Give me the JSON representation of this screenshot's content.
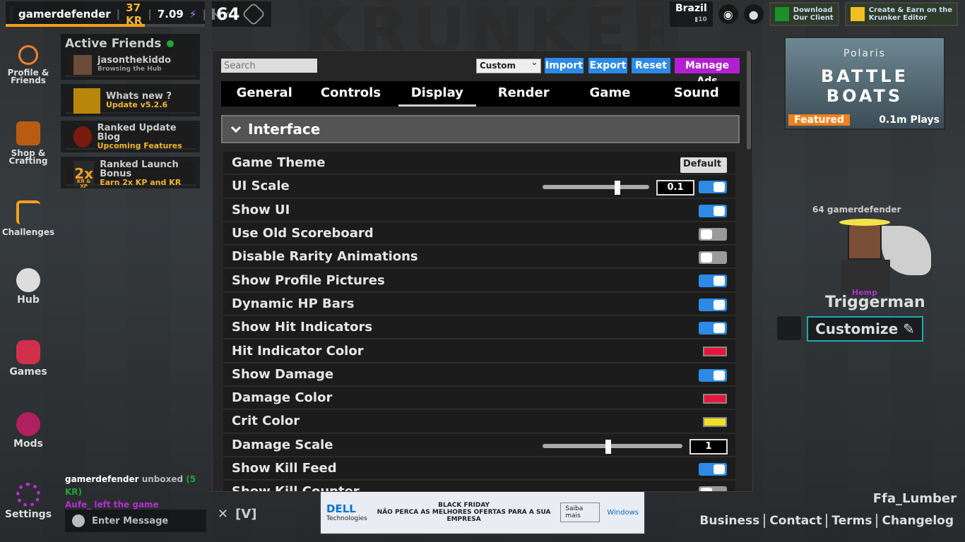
{
  "topbar": {
    "username": "gamerdefender",
    "kr": "37 KR",
    "kd": "7.09",
    "level": "64",
    "xp_fraction": 0.7,
    "region": "Brazil",
    "ping": "10",
    "promo_client_line1": "Download",
    "promo_client_line2": "Our Client",
    "promo_editor_line1": "Create & Earn on the",
    "promo_editor_line2": "Krunker Editor"
  },
  "background_logo": "KRUNKER",
  "sidebar": {
    "items": [
      {
        "label": "Profile & Friends"
      },
      {
        "label": "Shop & Crafting"
      },
      {
        "label": "Challenges"
      },
      {
        "label": "Hub"
      },
      {
        "label": "Games"
      },
      {
        "label": "Mods"
      },
      {
        "label": "Settings"
      }
    ]
  },
  "friends_panel": {
    "title": "Active Friends",
    "friend_name": "jasonthekiddo",
    "friend_status": "Browsing the Hub",
    "news": [
      {
        "title": "Whats new ?",
        "subtitle": "Update v5.2.6"
      },
      {
        "title": "Ranked Update Blog",
        "subtitle": "Upcoming Features"
      },
      {
        "title": "Ranked Launch Bonus",
        "subtitle": "Earn 2x KP and KR",
        "badge": "2x",
        "badge_sub": "KR & XP"
      }
    ]
  },
  "chat": {
    "msg1_user": "gamerdefender",
    "msg1_text": "unboxed",
    "msg1_kr": "(5 KR)",
    "msg2": "Aufe_ left the game",
    "input_placeholder": "Enter Message",
    "voice_key": "[V]"
  },
  "ad": {
    "brand": "DELL",
    "brand_sub": "Technologies",
    "header": "BLACK FRIDAY",
    "message": "NÃO PERCA AS MELHORES OFERTAS PARA A SUA EMPRESA",
    "cta": "Saiba mais",
    "partner": "Windows"
  },
  "featured": {
    "brand": "Polaris",
    "game": "BATTLE BOATS",
    "tag": "Featured",
    "plays": "0.1m Plays"
  },
  "player": {
    "info": "64 gamerdefender",
    "skin_tag": "Hemp",
    "skin_name": "Triggerman",
    "customize_label": "Customize"
  },
  "map_name": "Ffa_Lumber",
  "footer_links": [
    "Business",
    "Contact",
    "Terms",
    "Changelog"
  ],
  "settings": {
    "search_placeholder": "Search",
    "preset": "Custom",
    "buttons": {
      "import": "Import",
      "export": "Export",
      "reset": "Reset",
      "manage_ads": "Manage Ads"
    },
    "tabs": [
      "General",
      "Controls",
      "Display",
      "Render",
      "Game",
      "Sound"
    ],
    "active_tab": "Display",
    "section": "Interface",
    "rows": [
      {
        "label": "Game Theme",
        "type": "select",
        "value": "Default"
      },
      {
        "label": "UI Scale",
        "type": "slider-toggle",
        "value": "0.1",
        "slider": 0.7,
        "on": true
      },
      {
        "label": "Show UI",
        "type": "toggle",
        "on": true
      },
      {
        "label": "Use Old Scoreboard",
        "type": "toggle",
        "on": false
      },
      {
        "label": "Disable Rarity Animations",
        "type": "toggle",
        "on": false
      },
      {
        "label": "Show Profile Pictures",
        "type": "toggle",
        "on": true
      },
      {
        "label": "Dynamic HP Bars",
        "type": "toggle",
        "on": true
      },
      {
        "label": "Show Hit Indicators",
        "type": "toggle",
        "on": true
      },
      {
        "label": "Hit Indicator Color",
        "type": "color",
        "color": "#e8143c"
      },
      {
        "label": "Show Damage",
        "type": "toggle",
        "on": true
      },
      {
        "label": "Damage Color",
        "type": "color",
        "color": "#e8143c"
      },
      {
        "label": "Crit Color",
        "type": "color",
        "color": "#f3e024"
      },
      {
        "label": "Damage Scale",
        "type": "slider",
        "value": "1",
        "slider": 0.47
      },
      {
        "label": "Show Kill Feed",
        "type": "toggle",
        "on": true
      },
      {
        "label": "Show Kill Counter",
        "type": "toggle",
        "on": false
      }
    ]
  }
}
